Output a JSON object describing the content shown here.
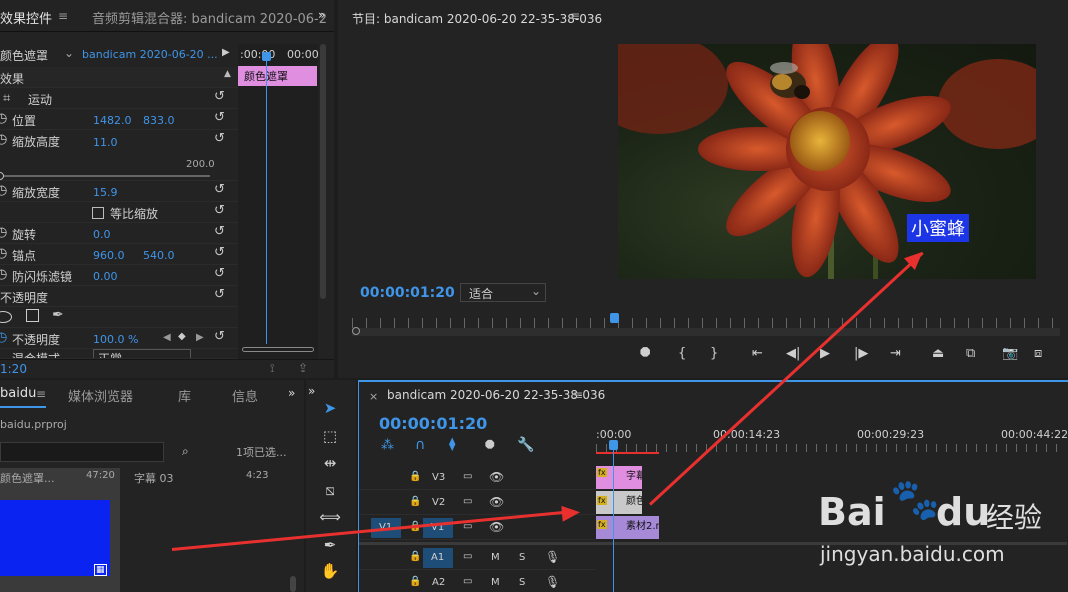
{
  "effect_controls": {
    "tabs": [
      "效果控件",
      "音频剪辑混合器: bandicam 2020-06-2"
    ],
    "source_label": "颜色遮罩",
    "clip_select": "bandicam 2020-06-20 ...",
    "timecode_a": ":00:00",
    "timecode_b": "00:00",
    "mini_clip": "颜色遮罩",
    "section": "效果",
    "motion": "运动",
    "position": {
      "label": "位置",
      "x": "1482.0",
      "y": "833.0"
    },
    "scale_h": {
      "label": "缩放高度",
      "value": "11.0"
    },
    "slider_max": "200.0",
    "scale_w": {
      "label": "缩放宽度",
      "value": "15.9"
    },
    "uniform": "等比缩放",
    "rotation": {
      "label": "旋转",
      "value": "0.0"
    },
    "anchor": {
      "label": "锚点",
      "x": "960.0",
      "y": "540.0"
    },
    "flicker": {
      "label": "防闪烁滤镜",
      "value": "0.00"
    },
    "opacity_section": "不透明度",
    "opacity": {
      "label": "不透明度",
      "value": "100.0 %"
    },
    "blend": {
      "label": "混合模式",
      "value": "正常"
    },
    "bottom_timecode": "1:20"
  },
  "program": {
    "title": "节目: bandicam 2020-06-20 22-35-38-036",
    "timecode": "00:00:01:20",
    "fit": "适合",
    "caption": "小蜜蜂"
  },
  "project": {
    "tabs": [
      "baidu",
      "媒体浏览器",
      "库",
      "信息"
    ],
    "file": "baidu.prproj",
    "selection": "1项已选...",
    "item1_name": "颜色遮罩...",
    "item1_dur": "47:20",
    "item2_name": "字幕 03",
    "item2_dur": "4:23"
  },
  "timeline": {
    "tab": "bandicam 2020-06-20 22-35-38-036",
    "timecode": "00:00:01:20",
    "ruler": [
      ":00:00",
      "00:00:14:23",
      "00:00:29:23",
      "00:00:44:22"
    ],
    "tracks_video": [
      "V3",
      "V2",
      "V1"
    ],
    "tracks_audio": [
      "A1",
      "A2"
    ],
    "source_tag": "V1",
    "clip_v3": "字幕",
    "clip_v2": "颜色",
    "clip_v1": "素材2.n",
    "m": "M",
    "s": "S"
  },
  "watermark": {
    "brand": "Bai",
    "brand2": "经验",
    "url": "jingyan.baidu.com"
  },
  "colors": {
    "accent": "#3f95e8",
    "arrow": "#e8312f",
    "caption_bg": "#1c35e6",
    "clip_pink": "#e08fe0",
    "clip_gray": "#c9c9c9",
    "clip_purple": "#a68ad8",
    "blue_thumb": "#0a23f0"
  }
}
